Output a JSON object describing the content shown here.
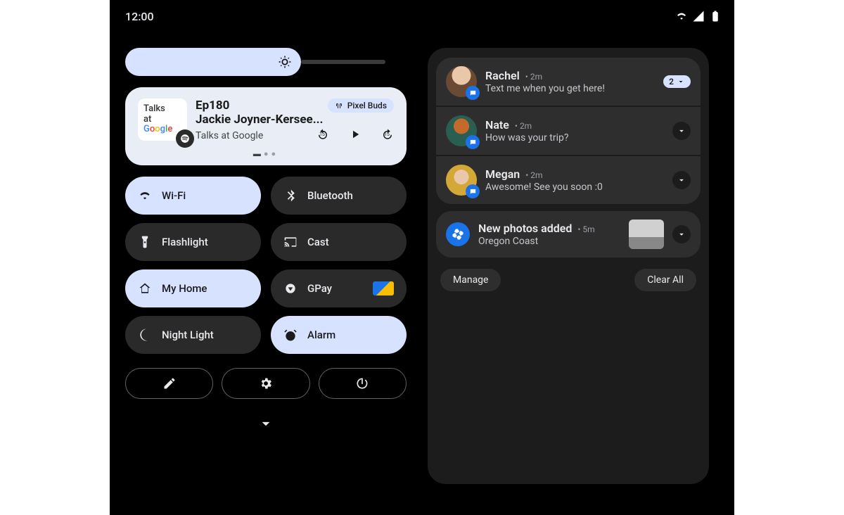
{
  "statusbar": {
    "time": "12:00"
  },
  "media": {
    "art_line1": "Talks",
    "art_line2": "at",
    "title_line1": "Ep180",
    "title_line2": "Jackie Joyner-Kersee...",
    "subtitle": "Talks at Google",
    "output_device": "Pixel Buds",
    "rewind_seconds": "15",
    "forward_seconds": "15"
  },
  "qs": {
    "wifi": "Wi-Fi",
    "bluetooth": "Bluetooth",
    "flashlight": "Flashlight",
    "cast": "Cast",
    "home": "My Home",
    "gpay": "GPay",
    "nightlight": "Night Light",
    "alarm": "Alarm"
  },
  "notifications": {
    "group": [
      {
        "name": "Rachel",
        "time": "2m",
        "text": "Text me when you get here!",
        "count": "2"
      },
      {
        "name": "Nate",
        "time": "2m",
        "text": "How was your trip?"
      },
      {
        "name": "Megan",
        "time": "2m",
        "text": "Awesome! See you soon :0"
      }
    ],
    "photos": {
      "title": "New photos added",
      "time": "5m",
      "subtitle": "Oregon Coast"
    },
    "manage": "Manage",
    "clear": "Clear All"
  }
}
